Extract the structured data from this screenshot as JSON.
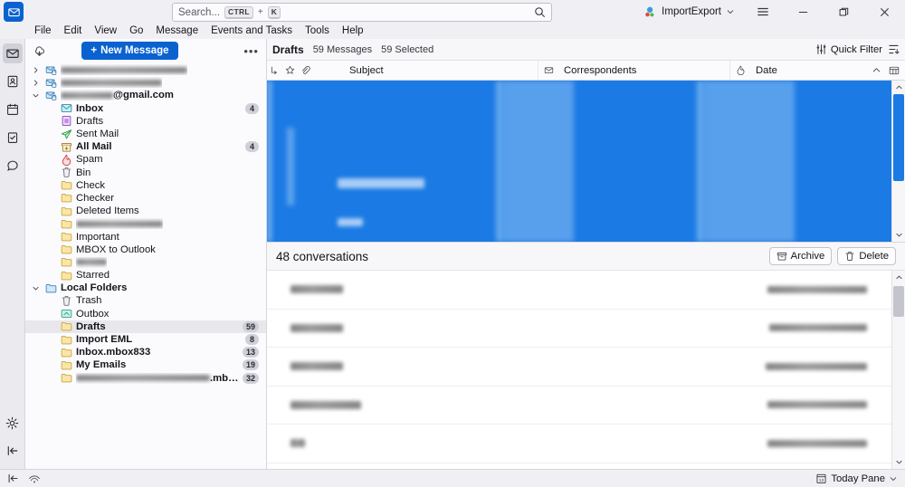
{
  "window": {
    "app_icon": "mail-icon",
    "profile_name": "ImportExport",
    "minimize_label": "Minimize",
    "restore_label": "Restore",
    "close_label": "Close",
    "menu_button_label": "App Menu"
  },
  "search": {
    "placeholder": "Search...",
    "shortcut_key1": "CTRL",
    "shortcut_plus": "+",
    "shortcut_key2": "K"
  },
  "menubar": {
    "items": [
      {
        "label": "File"
      },
      {
        "label": "Edit"
      },
      {
        "label": "View"
      },
      {
        "label": "Go"
      },
      {
        "label": "Message"
      },
      {
        "label": "Events and Tasks"
      },
      {
        "label": "Tools"
      },
      {
        "label": "Help"
      }
    ]
  },
  "rail": {
    "items": [
      {
        "name": "mail-icon",
        "active": true
      },
      {
        "name": "address-book-icon",
        "active": false
      },
      {
        "name": "calendar-icon",
        "active": false
      },
      {
        "name": "tasks-icon",
        "active": false
      },
      {
        "name": "chat-icon",
        "active": false
      }
    ],
    "settings_icon": "gear-icon",
    "collapse_icon": "collapse-icon"
  },
  "folder_pane": {
    "get_messages_icon": "get-messages-icon",
    "new_message_label": "New Message",
    "new_message_plus": "+",
    "more_label": "•••",
    "tree": [
      {
        "label": "",
        "redacted": true,
        "blur_width": 140,
        "icon": "account-icon",
        "indent": 0,
        "twisty": "collapsed",
        "bold": false
      },
      {
        "label": "",
        "redacted": true,
        "blur_width": 112,
        "icon": "account-icon",
        "indent": 0,
        "twisty": "collapsed",
        "bold": false
      },
      {
        "label": "@gmail.com",
        "redacted": true,
        "blur_width": 58,
        "icon": "account-icon",
        "indent": 0,
        "twisty": "expanded",
        "bold": true
      },
      {
        "label": "Inbox",
        "icon": "inbox-icon",
        "indent": 1,
        "bold": true,
        "badge": "4"
      },
      {
        "label": "Drafts",
        "icon": "drafts-icon",
        "indent": 1,
        "bold": false
      },
      {
        "label": "Sent Mail",
        "icon": "sent-icon",
        "indent": 1,
        "bold": false
      },
      {
        "label": "All Mail",
        "icon": "archive-icon",
        "indent": 1,
        "bold": true,
        "badge": "4"
      },
      {
        "label": "Spam",
        "icon": "spam-icon",
        "indent": 1,
        "bold": false
      },
      {
        "label": "Bin",
        "icon": "trash-icon",
        "indent": 1,
        "bold": false
      },
      {
        "label": "Check",
        "icon": "folder-icon",
        "indent": 1,
        "bold": false
      },
      {
        "label": "Checker",
        "icon": "folder-icon",
        "indent": 1,
        "bold": false
      },
      {
        "label": "Deleted Items",
        "icon": "folder-icon",
        "indent": 1,
        "bold": false
      },
      {
        "label": "",
        "redacted": true,
        "blur_width": 96,
        "icon": "folder-icon",
        "indent": 1,
        "bold": false
      },
      {
        "label": "Important",
        "icon": "folder-icon",
        "indent": 1,
        "bold": false
      },
      {
        "label": "MBOX to Outlook",
        "icon": "folder-icon",
        "indent": 1,
        "bold": false
      },
      {
        "label": "",
        "redacted": true,
        "blur_width": 34,
        "icon": "folder-icon",
        "indent": 1,
        "bold": false
      },
      {
        "label": "Starred",
        "icon": "folder-icon",
        "indent": 1,
        "bold": false
      },
      {
        "label": "Local Folders",
        "icon": "local-folders-icon",
        "indent": 0,
        "twisty": "expanded",
        "bold": true
      },
      {
        "label": "Trash",
        "icon": "trash-icon",
        "indent": 1,
        "bold": false
      },
      {
        "label": "Outbox",
        "icon": "outbox-icon",
        "indent": 1,
        "bold": false
      },
      {
        "label": "Drafts",
        "icon": "folder-icon",
        "indent": 1,
        "bold": true,
        "badge": "59",
        "selected": true
      },
      {
        "label": "Import EML",
        "icon": "folder-icon",
        "indent": 1,
        "bold": true,
        "badge": "8"
      },
      {
        "label": "Inbox.mbox833",
        "icon": "folder-icon",
        "indent": 1,
        "bold": true,
        "badge": "13"
      },
      {
        "label": "My Emails",
        "icon": "folder-icon",
        "indent": 1,
        "bold": true,
        "badge": "19"
      },
      {
        "label": ".mbox",
        "redacted": true,
        "blur_width": 148,
        "icon": "folder-icon",
        "indent": 1,
        "bold": true,
        "badge": "32"
      }
    ]
  },
  "message_header": {
    "folder_title": "Drafts",
    "message_count": "59 Messages",
    "selected_count": "59 Selected",
    "quick_filter_label": "Quick Filter",
    "quick_filter_icon": "filter-sliders-icon",
    "display_options_icon": "display-options-icon"
  },
  "columns": [
    {
      "name": "thread-column",
      "icon": "thread-icon"
    },
    {
      "name": "starred-column",
      "icon": "star-icon"
    },
    {
      "name": "attachment-column",
      "icon": "paperclip-icon"
    },
    {
      "name": "subject-column",
      "label": "Subject"
    },
    {
      "name": "unread-column",
      "icon": "unread-icon"
    },
    {
      "name": "correspondents-column",
      "label": "Correspondents"
    },
    {
      "name": "spam-column",
      "icon": "spam-small-icon"
    },
    {
      "name": "date-column",
      "label": "Date"
    }
  ],
  "thread_pane": {
    "selection_color": "#1b7ae4",
    "redacted": true,
    "note": "All message rows are selected and blurred for privacy"
  },
  "conversation_bar": {
    "title": "48 conversations",
    "archive_label": "Archive",
    "archive_icon": "archive-box-icon",
    "delete_label": "Delete",
    "delete_icon": "trash-icon"
  },
  "conversation_rows": [
    {
      "from_width": 58,
      "addr_width": 110,
      "redacted": true
    },
    {
      "from_width": 58,
      "addr_width": 108,
      "redacted": true
    },
    {
      "from_width": 58,
      "addr_width": 112,
      "redacted": true
    },
    {
      "from_width": 78,
      "addr_width": 110,
      "redacted": true
    },
    {
      "from_width": 16,
      "addr_width": 110,
      "redacted": true
    }
  ],
  "statusbar": {
    "collapse_icon": "collapse-pane-icon",
    "connection_icon": "connection-icon",
    "today_pane_label": "Today Pane",
    "today_pane_icon": "calendar-13-icon",
    "today_pane_chevron": "chevron-up-icon"
  },
  "colors": {
    "accent": "#0a62d0",
    "selection": "#1b7ae4",
    "chrome": "#f0f0f4",
    "pane": "#fbfbfe"
  }
}
